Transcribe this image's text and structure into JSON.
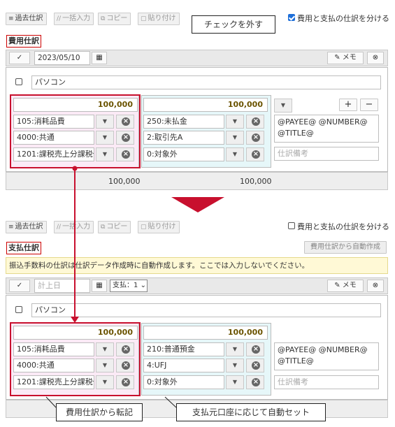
{
  "toolbar": {
    "past": "過去仕訳",
    "bulk": "一括入力",
    "copy": "コピー",
    "paste": "貼り付け"
  },
  "split_label": "費用と支払の仕訳を分ける",
  "callout_uncheck": "チェックを外す",
  "expense": {
    "section_title": "費用仕訳",
    "date": "2023/05/10",
    "memo_btn": "メモ",
    "description": "パソコン",
    "debit": {
      "amount": "100,000",
      "account": "105:消耗品費",
      "sub": "4000:共通",
      "tax": "1201:課税売上分課税仕"
    },
    "credit": {
      "amount": "100,000",
      "account": "250:未払金",
      "sub": "2:取引先A",
      "tax": "0:対象外"
    },
    "memo_text": "@PAYEE@ @NUMBER@ @TITLE@",
    "memo_placeholder": "仕訳備考",
    "total_debit": "100,000",
    "total_credit": "100,000"
  },
  "payment": {
    "section_title": "支払仕訳",
    "auto_btn": "費用仕訳から自動作成",
    "notice": "振込手数料の仕訳は仕訳データ作成時に自動作成します。ここでは入力しないでください。",
    "date_placeholder": "計上日",
    "pay_select": "支払：1",
    "memo_btn": "メモ",
    "description": "パソコン",
    "debit": {
      "amount": "100,000",
      "account": "105:消耗品費",
      "sub": "4000:共通",
      "tax": "1201:課税売上分課税仕"
    },
    "credit": {
      "amount": "100,000",
      "account": "210:普通預金",
      "sub": "4:UFJ",
      "tax": "0:対象外"
    },
    "memo_text": "@PAYEE@ @NUMBER@ @TITLE@",
    "memo_placeholder": "仕訳備考"
  },
  "callout_left": "費用仕訳から転記",
  "callout_right": "支払元口座に応じて自動セット",
  "colors": {
    "accent_red": "#c8102e",
    "debit_bg": "#fbeaf6",
    "credit_bg": "#e6f7f9"
  }
}
